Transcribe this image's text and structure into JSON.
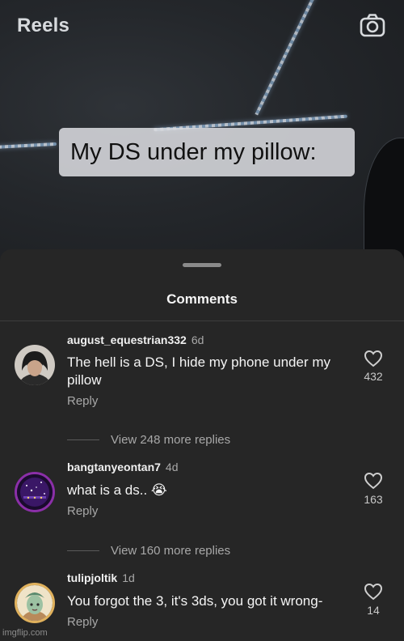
{
  "header": {
    "title": "Reels",
    "camera_icon": "camera-icon"
  },
  "reel": {
    "caption": "My DS under my pillow:"
  },
  "comments_sheet": {
    "title": "Comments",
    "comments": [
      {
        "username": "august_equestrian332",
        "time": "6d",
        "text": "The hell is a DS, I hide my phone under my pillow",
        "reply_label": "Reply",
        "likes": "432",
        "view_replies": "View 248 more replies"
      },
      {
        "username": "bangtanyeontan7",
        "time": "4d",
        "text": "what is a ds.. 😭",
        "reply_label": "Reply",
        "likes": "163",
        "view_replies": "View 160 more replies"
      },
      {
        "username": "tulipjoltik",
        "time": "1d",
        "text": "You forgot the 3, it's 3ds, you got it wrong-",
        "reply_label": "Reply",
        "likes": "14"
      }
    ]
  },
  "watermark": "imgflip.com",
  "colors": {
    "sheet_bg": "#262626",
    "muted_text": "#a8a8a8",
    "text": "#f4f4f4"
  }
}
